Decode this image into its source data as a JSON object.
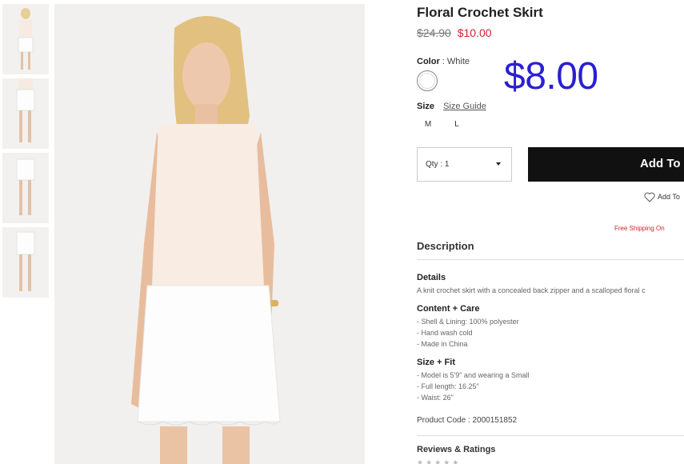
{
  "product": {
    "title": "Floral Crochet Skirt",
    "old_price": "$24.90",
    "sale_price": "$10.00",
    "overlay_price": "$8.00"
  },
  "color": {
    "label": "Color",
    "separator": ":",
    "value": "White",
    "swatch_hex": "#ffffff"
  },
  "size": {
    "label": "Size",
    "guide_label": "Size Guide",
    "options": [
      "M",
      "L"
    ]
  },
  "purchase": {
    "qty_label": "Qty : 1",
    "add_button_label": "Add To",
    "wishlist_label": "Add To",
    "shipping_text": "Free Shipping On",
    "shipping_color": "#d0242c"
  },
  "description": {
    "heading": "Description",
    "details_heading": "Details",
    "details_text": "A knit crochet skirt with a concealed back zipper and a scalloped floral c",
    "content_heading": "Content + Care",
    "content_lines": [
      "- Shell & Lining: 100% polyester",
      "- Hand wash cold",
      "- Made in China"
    ],
    "fit_heading": "Size + Fit",
    "fit_lines": [
      "- Model is 5'9\" and wearing a Small",
      "- Full length: 16.25\"",
      "- Waist: 26\""
    ],
    "product_code": "Product Code : 2000151852"
  },
  "reviews": {
    "heading": "Reviews & Ratings",
    "stars": "★★★★★"
  },
  "accent": {
    "overlay_price_color": "#2a1fd2",
    "button_color": "#111111"
  },
  "icons": {
    "wishlist": "heart-icon",
    "qty": "caret-down-icon"
  }
}
